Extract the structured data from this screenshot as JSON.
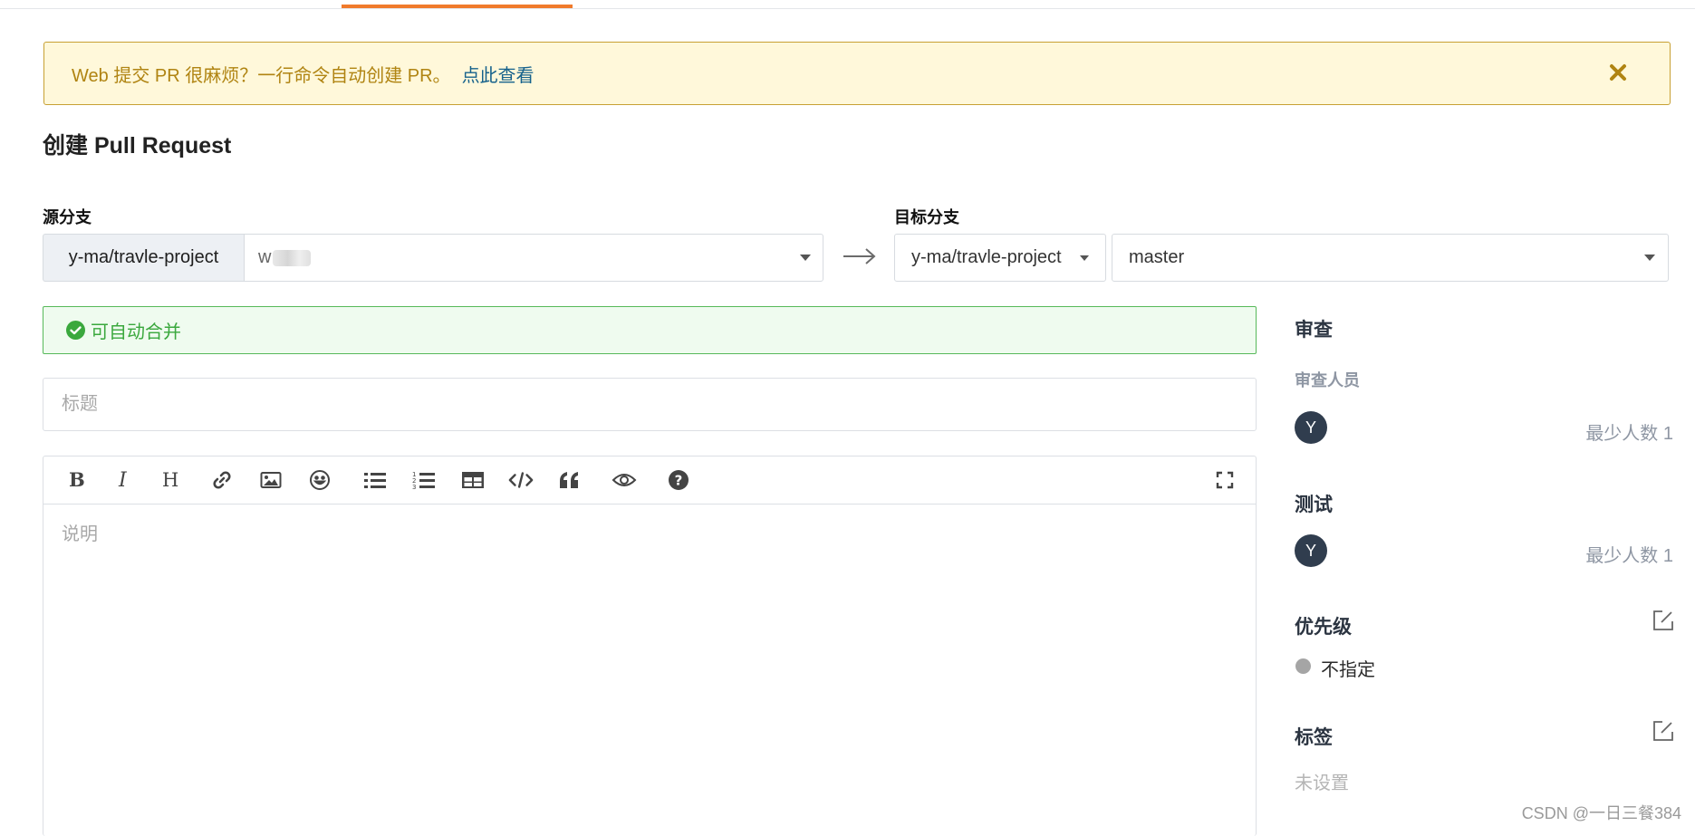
{
  "banner": {
    "text": "Web 提交 PR 很麻烦？一行命令自动创建 PR。",
    "link": "点此查看"
  },
  "page_title": "创建 Pull Request",
  "source": {
    "label": "源分支",
    "repo": "y-ma/travle-project",
    "branch": "w"
  },
  "target": {
    "label": "目标分支",
    "repo": "y-ma/travle-project",
    "branch": "master"
  },
  "merge_status": "可自动合并",
  "form": {
    "title_placeholder": "标题",
    "description_placeholder": "说明"
  },
  "toolbar": {
    "buttons": [
      "bold-icon",
      "italic-icon",
      "heading-icon",
      "link-icon",
      "image-icon",
      "emoji-icon",
      "bullet-list-icon",
      "numbered-list-icon",
      "table-icon",
      "code-icon",
      "quote-icon",
      "preview-eye-icon",
      "help-icon",
      "fullscreen-icon"
    ]
  },
  "sidebar": {
    "review": {
      "heading": "审查",
      "reviewers_label": "审查人员",
      "avatar_letter": "Y",
      "min_count": "最少人数 1"
    },
    "testing": {
      "heading": "测试",
      "avatar_letter": "Y",
      "min_count": "最少人数 1"
    },
    "priority": {
      "heading": "优先级",
      "value": "不指定"
    },
    "labels": {
      "heading": "标签",
      "value": "未设置"
    }
  },
  "watermark": "CSDN @一日三餐384",
  "colors": {
    "accent_tab": "#f07a2b",
    "banner_bg": "#fff8da",
    "banner_text": "#b08412",
    "link": "#16628c",
    "success": "#3aa83d",
    "avatar_bg": "#303d4e"
  }
}
